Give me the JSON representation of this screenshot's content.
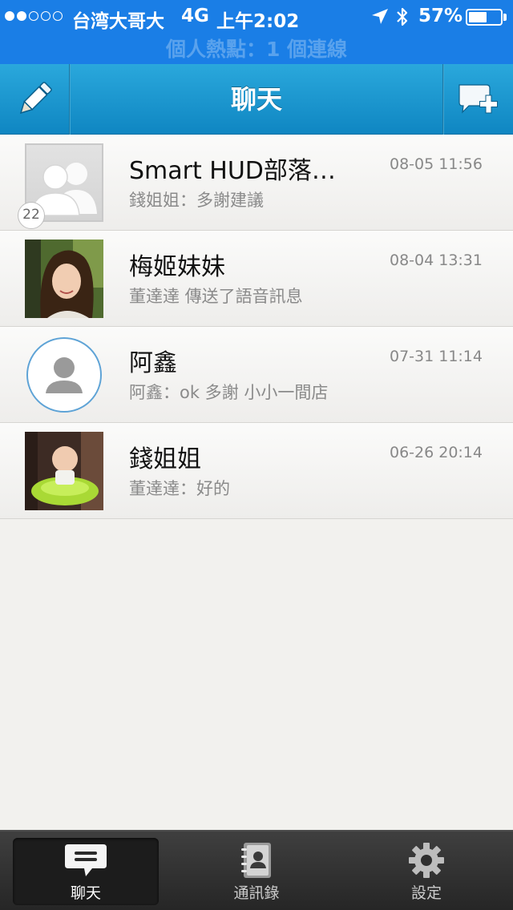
{
  "status_bar": {
    "carrier": "台湾大哥大",
    "network": "4G",
    "time": "上午2:02",
    "battery": "57%",
    "battery_level": 0.57,
    "hotspot": "個人熱點：1 個連線"
  },
  "nav": {
    "title": "聊天",
    "left_icon": "pencil-icon",
    "right_icon": "new-chat-icon"
  },
  "chats": [
    {
      "name": "Smart HUD部落…",
      "preview": "錢姐姐：多謝建議",
      "time": "08-05 11:56",
      "avatar": "group",
      "member_count": "22"
    },
    {
      "name": "梅姬妹妹",
      "preview": "董達達 傳送了語音訊息",
      "time": "08-04 13:31",
      "avatar": "photo-woman"
    },
    {
      "name": "阿鑫",
      "preview": "阿鑫：ok 多謝 小小一間店",
      "time": "07-31 11:14",
      "avatar": "default-person"
    },
    {
      "name": "錢姐姐",
      "preview": "董達達：好的",
      "time": "06-26 20:14",
      "avatar": "photo-baby"
    }
  ],
  "tabs": [
    {
      "label": "聊天",
      "icon": "chat-bubble-icon",
      "active": true
    },
    {
      "label": "通訊錄",
      "icon": "contacts-book-icon",
      "active": false
    },
    {
      "label": "設定",
      "icon": "gear-icon",
      "active": false
    }
  ],
  "colors": {
    "status_bar": "#1a7ee6",
    "nav_bar": "#1b96cf",
    "tab_bar": "#2e2e2e",
    "background": "#f2f1ee"
  }
}
